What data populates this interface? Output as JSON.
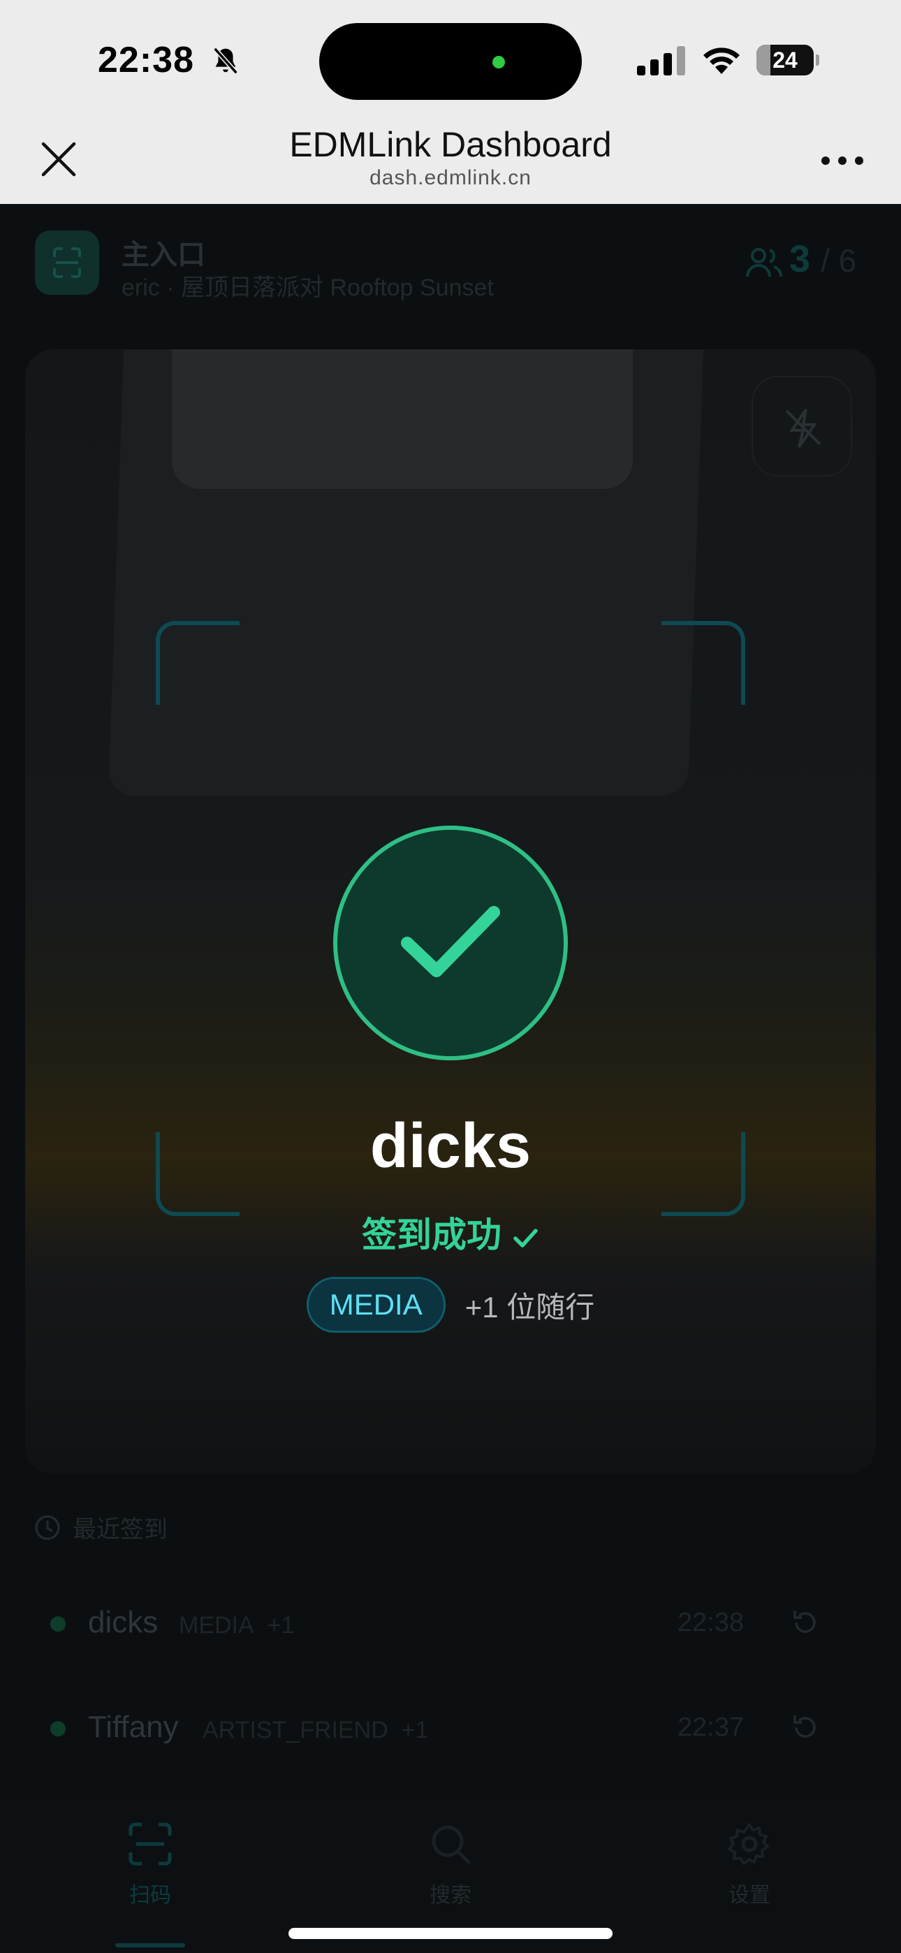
{
  "status_bar": {
    "time": "22:38",
    "battery_level": "24",
    "battery_fraction": 0.24
  },
  "browser": {
    "title": "EDMLink Dashboard",
    "url": "dash.edmlink.cn"
  },
  "gate": {
    "name": "主入口",
    "subtitle": "eric · 屋顶日落派对 Rooftop Sunset",
    "checked_in": "3",
    "capacity_text": "/ 6"
  },
  "recent": {
    "heading": "最近签到",
    "items": [
      {
        "name": "dicks",
        "tag": "MEDIA",
        "plus": "+1",
        "time": "22:38"
      },
      {
        "name": "Tiffany",
        "tag": "ARTIST_FRIEND",
        "plus": "+1",
        "time": "22:37"
      }
    ]
  },
  "tabs": [
    {
      "label": "扫码",
      "icon": "scan-icon",
      "active": true
    },
    {
      "label": "搜索",
      "icon": "search-icon",
      "active": false
    },
    {
      "label": "设置",
      "icon": "gear-icon",
      "active": false
    }
  ],
  "success": {
    "name": "dicks",
    "status": "签到成功",
    "tag": "MEDIA",
    "companion": "+1 位随行"
  },
  "colors": {
    "success_green": "#34d399",
    "tag_cyan": "#5de0f5",
    "scanner_teal": "#0e4a52"
  }
}
